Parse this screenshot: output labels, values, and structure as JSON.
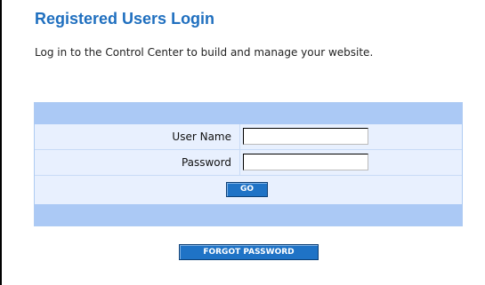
{
  "header": {
    "title": "Registered Users Login",
    "intro": "Log in to the Control Center to build and manage your website."
  },
  "login_form": {
    "username_label": "User Name",
    "username_value": "",
    "password_label": "Password",
    "password_value": "",
    "go_label": "GO"
  },
  "forgot_password_label": "FORGOT PASSWORD",
  "colors": {
    "title": "#1f6fbf",
    "band": "#abc9f5",
    "panel": "#e8f0fe",
    "button": "#1f73c6"
  }
}
